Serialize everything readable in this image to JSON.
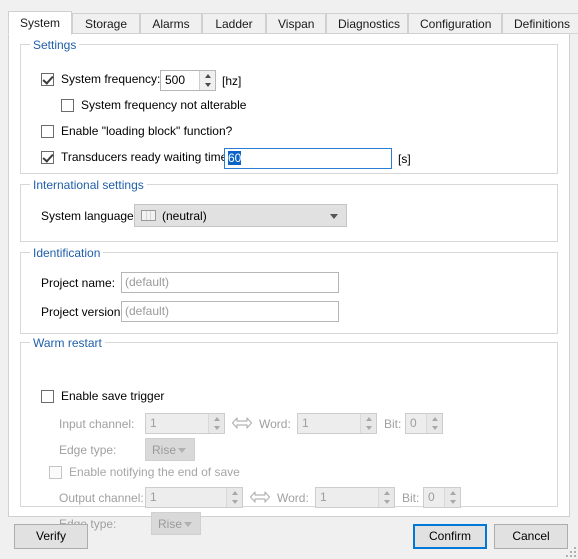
{
  "tabs": [
    {
      "label": "System",
      "active": true
    },
    {
      "label": "Storage",
      "active": false
    },
    {
      "label": "Alarms",
      "active": false
    },
    {
      "label": "Ladder",
      "active": false
    },
    {
      "label": "Vispan",
      "active": false
    },
    {
      "label": "Diagnostics",
      "active": false
    },
    {
      "label": "Configuration",
      "active": false
    },
    {
      "label": "Definitions",
      "active": false
    }
  ],
  "settings": {
    "legend": "Settings",
    "system_frequency": {
      "label": "System frequency:",
      "checked": true,
      "value": "500",
      "unit": "[hz]"
    },
    "not_alterable": {
      "label": "System frequency not alterable",
      "checked": false
    },
    "loading_block": {
      "label": "Enable \"loading block\" function?",
      "checked": false
    },
    "transducers": {
      "label": "Transducers ready waiting time:",
      "checked": true,
      "value": "60",
      "unit": "[s]"
    }
  },
  "international": {
    "legend": "International settings",
    "system_language": {
      "label": "System language:",
      "value": "(neutral)",
      "icon": "flag-neutral-icon"
    }
  },
  "identification": {
    "legend": "Identification",
    "project_name": {
      "label": "Project name:",
      "value": "",
      "placeholder": "(default)"
    },
    "project_version": {
      "label": "Project version:",
      "value": "",
      "placeholder": "(default)"
    }
  },
  "warm_restart": {
    "legend": "Warm restart",
    "enable_save_trigger": {
      "label": "Enable save trigger",
      "checked": false
    },
    "input_channel": {
      "label": "Input channel:",
      "value": "1"
    },
    "input_word": {
      "label": "Word:",
      "value": "1"
    },
    "input_bit": {
      "label": "Bit:",
      "value": "0"
    },
    "input_edge_type": {
      "label": "Edge type:",
      "value": "Rise"
    },
    "enable_notify": {
      "label": "Enable notifying the end of save",
      "checked": false
    },
    "output_channel": {
      "label": "Output channel:",
      "value": "1"
    },
    "output_word": {
      "label": "Word:",
      "value": "1"
    },
    "output_bit": {
      "label": "Bit:",
      "value": "0"
    },
    "output_edge_type": {
      "label": "Edge type:",
      "value": "Rise"
    },
    "link_icon": "swap-arrows-icon"
  },
  "footer": {
    "verify": "Verify",
    "confirm": "Confirm",
    "cancel": "Cancel"
  },
  "colors": {
    "group_legend": "#1f5fa9",
    "focus_blue": "#0078d7",
    "selection_blue": "#0a64c8",
    "window_bg": "#f0f0f0",
    "panel_bg": "#ffffff"
  }
}
